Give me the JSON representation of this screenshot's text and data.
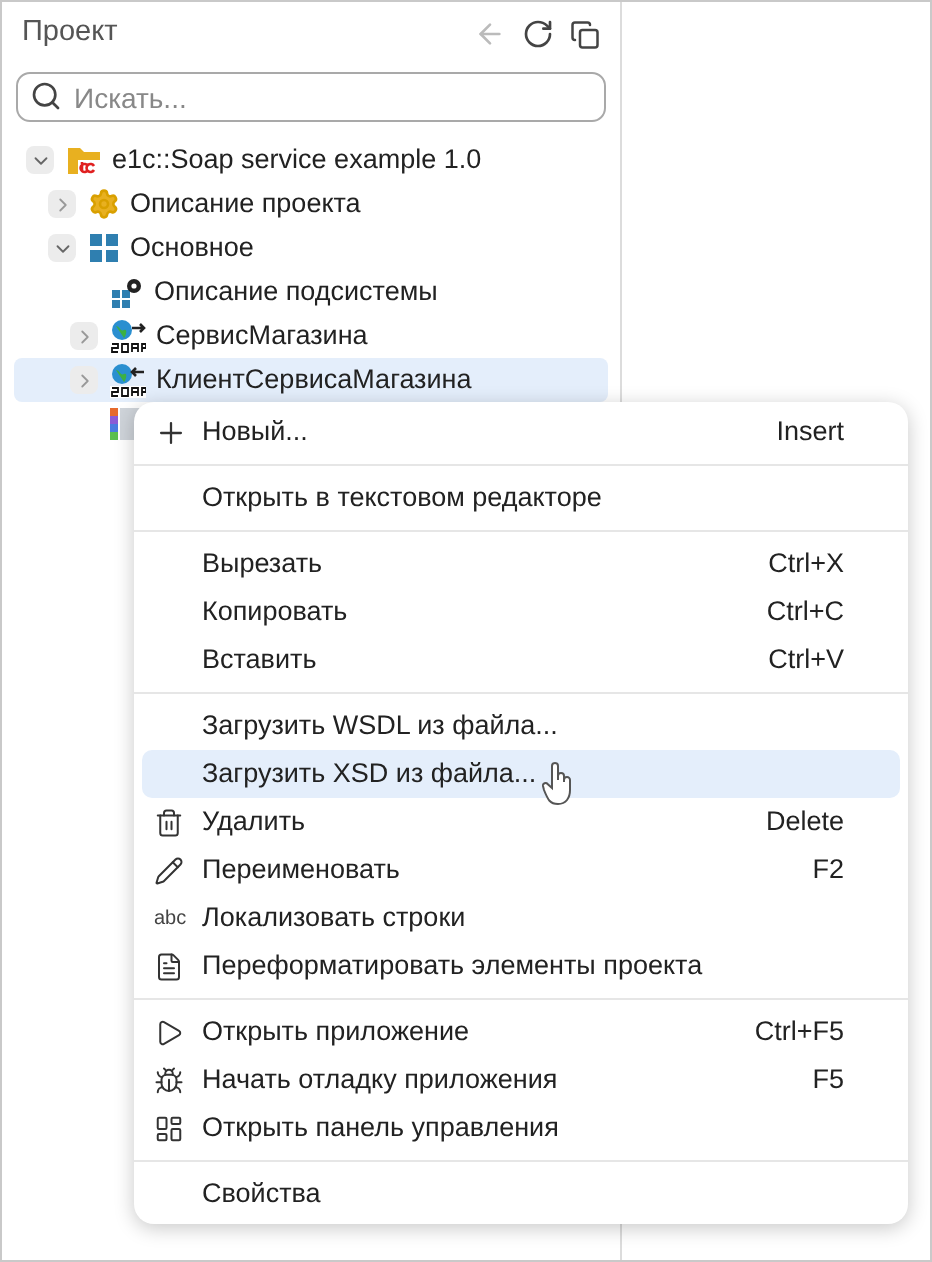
{
  "panel": {
    "title": "Проект"
  },
  "search": {
    "placeholder": "Искать..."
  },
  "tree": [
    {
      "label": "e1c::Soap service example 1.0",
      "kind": "project",
      "expanded": true,
      "selected": false,
      "children": [
        {
          "label": "Описание проекта",
          "kind": "gear",
          "expanded": false,
          "selected": false
        },
        {
          "label": "Основное",
          "kind": "subsystem",
          "expanded": true,
          "selected": false,
          "children": [
            {
              "label": "Описание подсистемы",
              "kind": "subsystem-gear",
              "selected": false
            },
            {
              "label": "СервисМагазина",
              "kind": "soap-out",
              "expanded": false,
              "selected": false
            },
            {
              "label": "КлиентСервисаМагазина",
              "kind": "soap-in",
              "expanded": false,
              "selected": true
            },
            {
              "kind": "palette",
              "selected": false
            }
          ]
        }
      ]
    }
  ],
  "menu": {
    "groups": [
      [
        {
          "label": "Новый...",
          "shortcut": "Insert",
          "kind": "plus",
          "selected": false
        }
      ],
      [
        {
          "label": "Открыть в текстовом редакторе",
          "selected": false
        }
      ],
      [
        {
          "label": "Вырезать",
          "shortcut": "Ctrl+X",
          "selected": false
        },
        {
          "label": "Копировать",
          "shortcut": "Ctrl+C",
          "selected": false
        },
        {
          "label": "Вставить",
          "shortcut": "Ctrl+V",
          "selected": false
        }
      ],
      [
        {
          "label": "Загрузить WSDL из файла...",
          "selected": false
        },
        {
          "label": "Загрузить XSD из файла...",
          "selected": true
        },
        {
          "label": "Удалить",
          "shortcut": "Delete",
          "kind": "trash",
          "selected": false
        },
        {
          "label": "Переименовать",
          "shortcut": "F2",
          "kind": "pencil",
          "selected": false
        },
        {
          "label": "Локализовать строки",
          "icon_text": "abc",
          "selected": false
        },
        {
          "label": "Переформатировать элементы проекта",
          "kind": "format",
          "selected": false
        }
      ],
      [
        {
          "label": "Открыть приложение",
          "shortcut": "Ctrl+F5",
          "kind": "play",
          "selected": false
        },
        {
          "label": "Начать отладку приложения",
          "shortcut": "F5",
          "kind": "debug",
          "selected": false
        },
        {
          "label": "Открыть панель управления",
          "kind": "panel",
          "selected": false
        }
      ],
      [
        {
          "label": "Свойства",
          "selected": false
        }
      ]
    ]
  }
}
